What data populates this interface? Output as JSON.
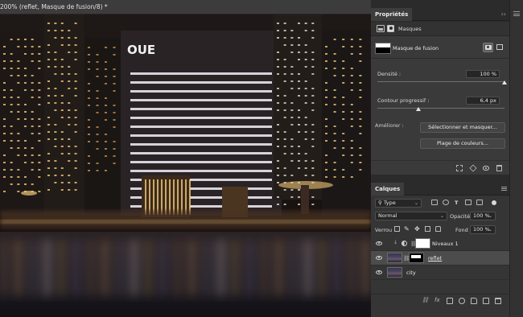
{
  "document": {
    "tab_label": "200% (reflet, Masque de fusion/8) *"
  },
  "properties": {
    "title": "Propriétés",
    "masks_label": "Masques",
    "mask_name": "Masque de fusion",
    "density_label": "Densité :",
    "density_value": "100 %",
    "density_level": 1.0,
    "feather_label": "Contour progressif :",
    "feather_value": "6,4 px",
    "feather_level": 0.32,
    "improve_label": "Améliorer :",
    "select_mask_button": "Sélectionner et masquer...",
    "color_range_button": "Plage de couleurs...",
    "footer_icons": [
      "load-selection-icon",
      "apply-mask-icon",
      "toggle-mask-icon",
      "delete-mask-icon"
    ]
  },
  "layers": {
    "title": "Calques",
    "filter_kind": "Type",
    "filter_icons": [
      "pixel-filter-icon",
      "adjustment-filter-icon",
      "text-filter-icon",
      "shape-filter-icon",
      "smart-object-filter-icon"
    ],
    "blend_mode": "Normal",
    "opacity_label": "Opacité :",
    "opacity_value": "100 %",
    "lock_label": "Verrou :",
    "fill_label": "Fond :",
    "fill_value": "100 %",
    "items": [
      {
        "name": "Niveaux 1",
        "type": "adjustment",
        "visible": true,
        "selected": false
      },
      {
        "name": "reflet",
        "type": "pixel-with-mask",
        "visible": true,
        "selected": true
      },
      {
        "name": "city",
        "type": "pixel",
        "visible": true,
        "selected": false
      }
    ],
    "footer_icons": [
      "link-layers-icon",
      "fx-icon",
      "add-mask-icon",
      "new-adjustment-icon",
      "new-group-icon",
      "new-layer-icon",
      "delete-layer-icon"
    ]
  },
  "canvas": {
    "sign_text": "OUE"
  },
  "colors": {
    "panel_bg": "#3a3a3a",
    "selected_layer": "#4c4c4c",
    "city_light": "#f2c778"
  }
}
